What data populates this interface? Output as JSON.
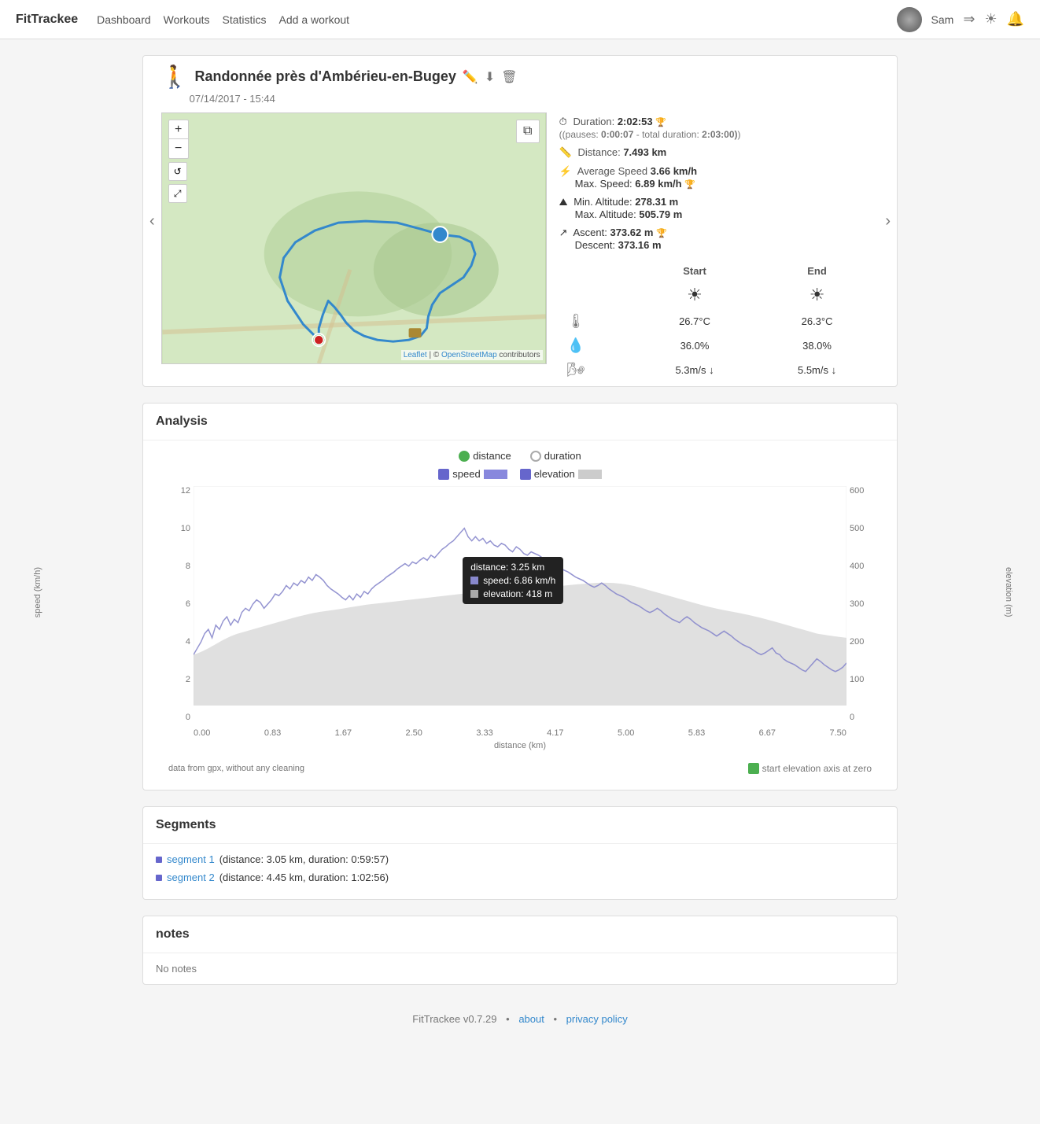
{
  "brand": "FitTrackee",
  "nav": {
    "links": [
      "Dashboard",
      "Workouts",
      "Statistics",
      "Add a workout"
    ],
    "username": "Sam"
  },
  "workout": {
    "title": "Randonnée près d'Ambérieu-en-Bugey",
    "date": "07/14/2017 - 15:44",
    "duration_label": "Duration:",
    "duration_value": "2:02:53",
    "pauses_label": "(pauses:",
    "pauses_value": "0:00:07",
    "total_label": "total duration:",
    "total_value": "2:03:00)",
    "distance_label": "Distance:",
    "distance_value": "7.493 km",
    "avg_speed_label": "Average Speed",
    "avg_speed_value": "3.66 km/h",
    "max_speed_label": "Max. Speed:",
    "max_speed_value": "6.89 km/h",
    "min_alt_label": "Min. Altitude:",
    "min_alt_value": "278.31 m",
    "max_alt_label": "Max. Altitude:",
    "max_alt_value": "505.79 m",
    "ascent_label": "Ascent:",
    "ascent_value": "373.62 m",
    "descent_label": "Descent:",
    "descent_value": "373.16 m",
    "weather": {
      "start_label": "Start",
      "end_label": "End",
      "temp_start": "26.7°C",
      "temp_end": "26.3°C",
      "humidity_start": "36.0%",
      "humidity_end": "38.0%",
      "wind_start": "5.3m/s ↓",
      "wind_end": "5.5m/s ↓"
    }
  },
  "analysis": {
    "title": "Analysis",
    "options": {
      "distance": "distance",
      "duration": "duration"
    },
    "series": {
      "speed": "speed",
      "elevation": "elevation"
    },
    "x_label": "distance (km)",
    "y_left_label": "speed (km/h)",
    "y_right_label": "elevation (m)",
    "x_ticks": [
      "0.00",
      "0.83",
      "1.67",
      "2.50",
      "3.33",
      "4.17",
      "5.00",
      "5.83",
      "6.67",
      "7.50"
    ],
    "y_left_ticks": [
      "0",
      "2",
      "4",
      "6",
      "8",
      "10",
      "12"
    ],
    "y_right_ticks": [
      "0",
      "100",
      "200",
      "300",
      "400",
      "500",
      "600"
    ],
    "tooltip": {
      "distance": "distance: 3.25 km",
      "speed": "speed: 6.86 km/h",
      "elevation": "elevation: 418 m"
    },
    "footer_note": "data from gpx, without any cleaning",
    "start_elevation_label": "start elevation axis at zero"
  },
  "segments": {
    "title": "Segments",
    "items": [
      {
        "name": "segment 1",
        "detail": "(distance: 3.05 km, duration: 0:59:57)"
      },
      {
        "name": "segment 2",
        "detail": "(distance: 4.45 km, duration: 1:02:56)"
      }
    ]
  },
  "notes": {
    "title": "notes",
    "content": "No notes"
  },
  "footer": {
    "brand": "FitTrackee",
    "version": "v0.7.29",
    "about": "about",
    "privacy": "privacy policy"
  }
}
